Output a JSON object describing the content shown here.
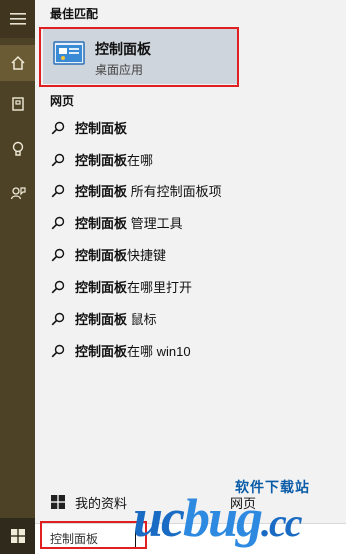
{
  "rail": {
    "icons": [
      "hamburger-icon",
      "home-icon",
      "notebook-icon",
      "lightbulb-icon",
      "feedback-icon",
      "windows-icon"
    ]
  },
  "best_match": {
    "section_title": "最佳匹配",
    "title": "控制面板",
    "subtitle": "桌面应用"
  },
  "web": {
    "section_title": "网页",
    "items": [
      {
        "bold": "控制面板",
        "rest": ""
      },
      {
        "bold": "控制面板",
        "rest": "在哪"
      },
      {
        "bold": "控制面板",
        "rest": " 所有控制面板项"
      },
      {
        "bold": "控制面板",
        "rest": " 管理工具"
      },
      {
        "bold": "控制面板",
        "rest": "快捷键"
      },
      {
        "bold": "控制面板",
        "rest": "在哪里打开"
      },
      {
        "bold": "控制面板",
        "rest": " 鼠标"
      },
      {
        "bold": "控制面板",
        "rest": "在哪 win10"
      }
    ]
  },
  "bottom": {
    "my_stuff": "我的资料",
    "web_label": "网页"
  },
  "search": {
    "value": "控制面板"
  },
  "watermark": {
    "top": "软件下载站",
    "main_a": "uc",
    "main_b": "bug",
    "main_c": ".cc"
  },
  "colors": {
    "rail_bg": "#4d4226",
    "panel_bg": "#f2f2f2",
    "highlight_bg": "#cfd5dc",
    "annotation_red": "#e02020",
    "watermark_blue": "#1a6bc4",
    "watermark_orange": "#f39a1e"
  }
}
